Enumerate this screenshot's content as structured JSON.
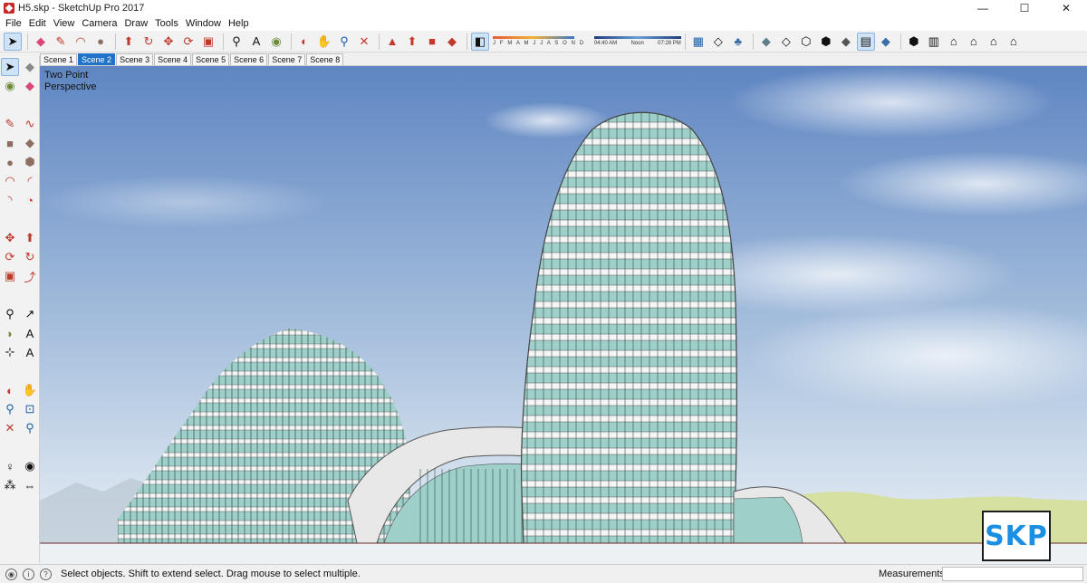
{
  "window": {
    "title": "H5.skp - SketchUp Pro 2017",
    "minimize": "—",
    "maximize": "☐",
    "close": "✕"
  },
  "menu": [
    "File",
    "Edit",
    "View",
    "Camera",
    "Draw",
    "Tools",
    "Window",
    "Help"
  ],
  "toolbar": {
    "months": "J F M A M J J A S O N D",
    "time_start": "04:40 AM",
    "time_mid": "Noon",
    "time_end": "07:28 PM"
  },
  "scenes": {
    "tabs": [
      "Scene 1",
      "Scene 2",
      "Scene 3",
      "Scene 4",
      "Scene 5",
      "Scene 6",
      "Scene 7",
      "Scene 8"
    ],
    "active": "Scene 2"
  },
  "viewport": {
    "camera_label_1": "Two Point",
    "camera_label_2": "Perspective",
    "sky_top": "#5f86c2",
    "sky_bottom": "#eef3f7",
    "glass_color": "#9fcfc9",
    "slab_color": "#f5f5f5",
    "ground_color": "#d6e0a0"
  },
  "badge": {
    "text": "SKP",
    "color": "#1a8fe3"
  },
  "status": {
    "hint": "Select objects. Shift to extend select. Drag mouse to select multiple.",
    "measurements_label": "Measurements",
    "measurements_value": ""
  }
}
